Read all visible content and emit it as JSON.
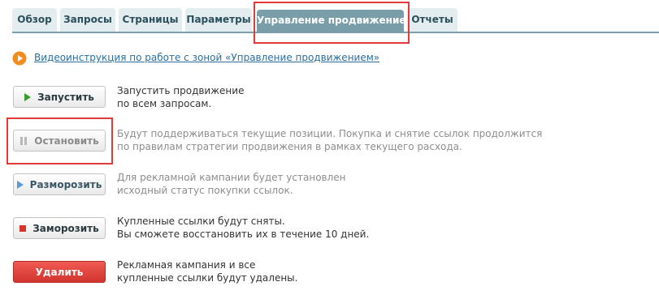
{
  "tabs": [
    {
      "label": "Обзор",
      "active": false
    },
    {
      "label": "Запросы",
      "active": false
    },
    {
      "label": "Страницы",
      "active": false
    },
    {
      "label": "Параметры",
      "active": false
    },
    {
      "label": "Управление продвижением",
      "active": true
    },
    {
      "label": "Отчеты",
      "active": false
    }
  ],
  "video": {
    "icon": "play-icon",
    "link_text": "Видеоинструкция по работе с зоной «Управление продвижением»"
  },
  "actions": {
    "start": {
      "label": "Запустить",
      "icon": "play-icon",
      "enabled": true,
      "desc_line1": "Запустить продвижение",
      "desc_line2": "по всем запросам."
    },
    "stop": {
      "label": "Остановить",
      "icon": "pause-icon",
      "enabled": false,
      "desc_line1": "Будут поддерживаться текущие позиции. Покупка и снятие ссылок продолжится",
      "desc_line2": "по правилам стратегии продвижения в рамках текущего расхода."
    },
    "unfreeze": {
      "label": "Разморозить",
      "icon": "play-icon",
      "enabled": false,
      "desc_line1": "Для рекламной кампании будет установлен",
      "desc_line2": "исходный статус покупки ссылок."
    },
    "freeze": {
      "label": "Заморозить",
      "icon": "stop-icon",
      "enabled": true,
      "desc_line1": "Купленные ссылки будут сняты.",
      "desc_line2": "Вы сможете восстановить их в течение 10 дней."
    },
    "delete": {
      "label": "Удалить",
      "enabled": true,
      "desc_line1": "Рекламная кампания и все",
      "desc_line2": "купленные ссылки будут удалены."
    }
  },
  "colors": {
    "active_tab": "#7a9ea9",
    "tab_bg": "#e3ecee",
    "highlight": "#e03a3a",
    "link": "#2a6fa0",
    "danger": "#d9342b"
  }
}
